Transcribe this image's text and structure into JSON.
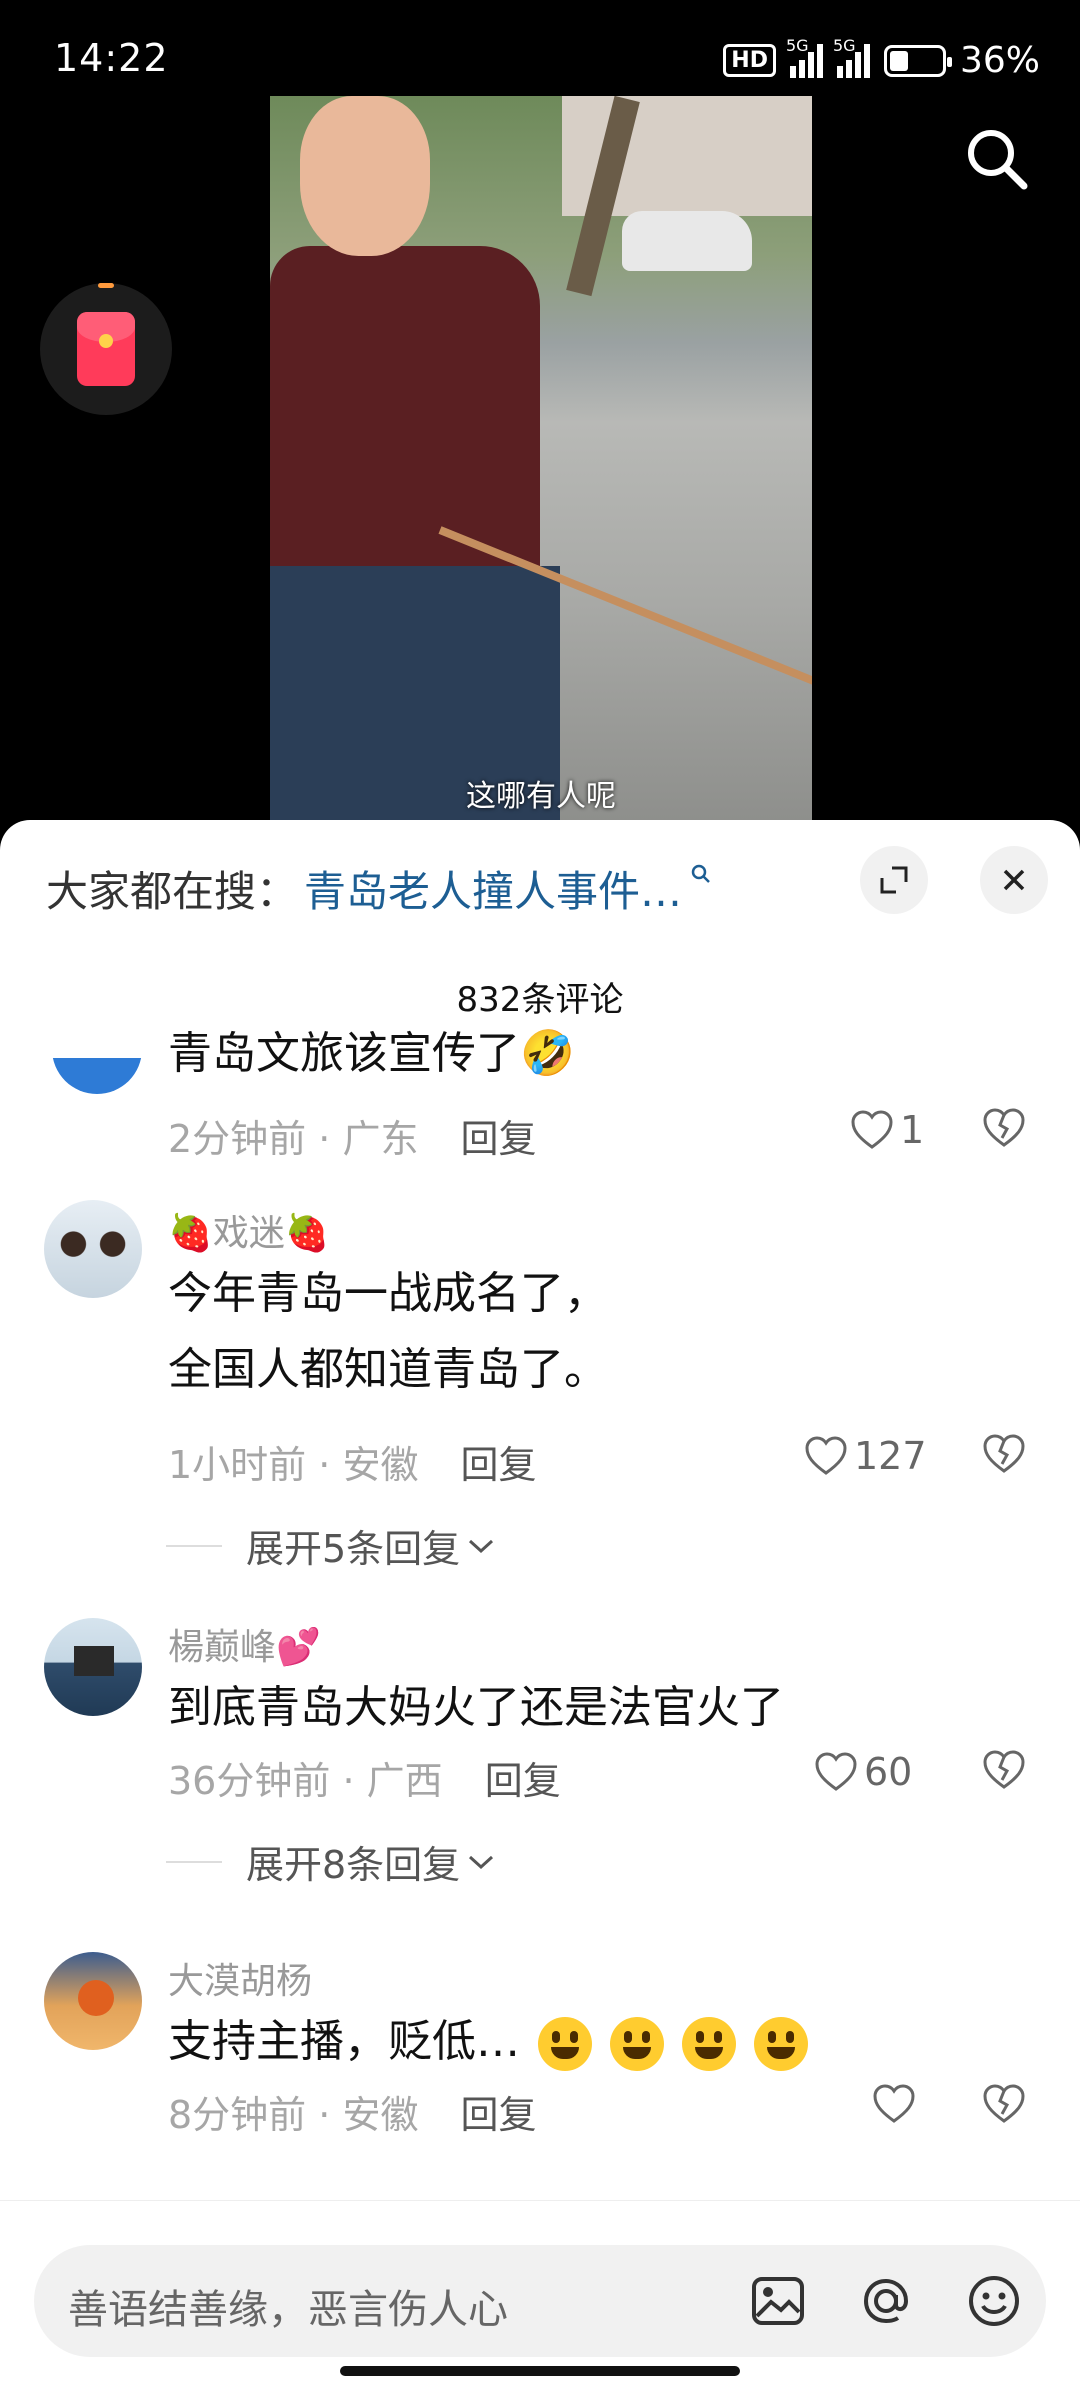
{
  "status_bar": {
    "time": "14:22",
    "hd": "HD",
    "network1": "5G",
    "network2": "5G",
    "battery": "36%"
  },
  "video": {
    "subtitle": "这哪有人呢"
  },
  "sheet": {
    "hot_search_label": "大家都在搜：",
    "hot_search_keyword": "青岛老人撞人事件…",
    "comment_count": "832条评论"
  },
  "comments": [
    {
      "nickname": "",
      "lines": [
        "青岛文旅该宣传了🤣"
      ],
      "time": "2分钟前",
      "region": "广东",
      "reply_label": "回复",
      "likes": "1"
    },
    {
      "nickname": "🍓戏迷🍓",
      "lines": [
        "今年青岛一战成名了，",
        "全国人都知道青岛了。"
      ],
      "time": "1小时前",
      "region": "安徽",
      "reply_label": "回复",
      "likes": "127",
      "expand": "展开5条回复"
    },
    {
      "nickname": "楊巅峰💕",
      "lines": [
        "到底青岛大妈火了还是法官火了"
      ],
      "time": "36分钟前",
      "region": "广西",
      "reply_label": "回复",
      "likes": "60",
      "expand": "展开8条回复"
    },
    {
      "nickname": "大漠胡杨",
      "lines": [
        "支持主播，贬低…"
      ],
      "time": "8分钟前",
      "region": "安徽",
      "reply_label": "回复",
      "likes": ""
    }
  ],
  "input": {
    "placeholder": "善语结善缘，恶言伤人心"
  },
  "icons": [
    "search-icon",
    "red-packet-icon",
    "expand-icon",
    "close-icon",
    "heart-icon",
    "broken-heart-icon",
    "image-icon",
    "at-icon",
    "emoji-icon",
    "chevron-down-icon"
  ]
}
